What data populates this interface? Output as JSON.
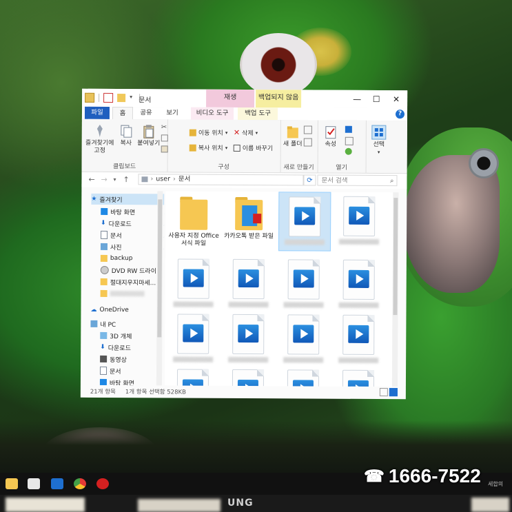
{
  "window": {
    "title": "문서",
    "context_tabs": {
      "play": "재생",
      "backup": "백업되지 않음"
    },
    "controls": {
      "minimize": "—",
      "maximize": "☐",
      "close": "✕"
    }
  },
  "tabs": [
    "파일",
    "홈",
    "공유",
    "보기",
    "비디오 도구",
    "백업 도구"
  ],
  "help_label": "?",
  "ribbon": {
    "clipboard": {
      "pin_label": "즐겨찾기에 고정",
      "copy_label": "복사",
      "paste_label": "붙여넣기",
      "group_label": "클립보드"
    },
    "organize": {
      "move_to": "이동 위치",
      "copy_to": "복사 위치",
      "delete": "삭제",
      "rename": "이름 바꾸기",
      "group_label": "구성"
    },
    "new": {
      "new_folder": "새 폴더",
      "group_label": "새로 만들기"
    },
    "open": {
      "properties": "속성",
      "group_label": "열기"
    },
    "select": {
      "select": "선택"
    }
  },
  "address": {
    "path": [
      "user",
      "문서"
    ],
    "search_placeholder": "문서 검색"
  },
  "nav": {
    "quick_access": "즐겨찾기",
    "quick_items": [
      "바탕 화면",
      "다운로드",
      "문서",
      "사진",
      "backup",
      "DVD RW 드라이",
      "절대지우지마세..."
    ],
    "onedrive": "OneDrive",
    "this_pc": "내 PC",
    "pc_items": [
      "3D 개체",
      "다운로드",
      "동영상",
      "문서",
      "바탕 화면"
    ]
  },
  "files": [
    {
      "type": "folder",
      "label": "사용자 지정 Office 서식 파일"
    },
    {
      "type": "kakao",
      "label": "카카오톡 받은 파일"
    }
  ],
  "status": {
    "count": "21개 항목",
    "selected": "1개 항목 선택함 528KB"
  },
  "overlay": {
    "phone": "1666-7522",
    "phone_icon": "☎",
    "sehap": "세합의"
  },
  "monitor_brand": "UNG",
  "accent_color": "#1f5fbf"
}
